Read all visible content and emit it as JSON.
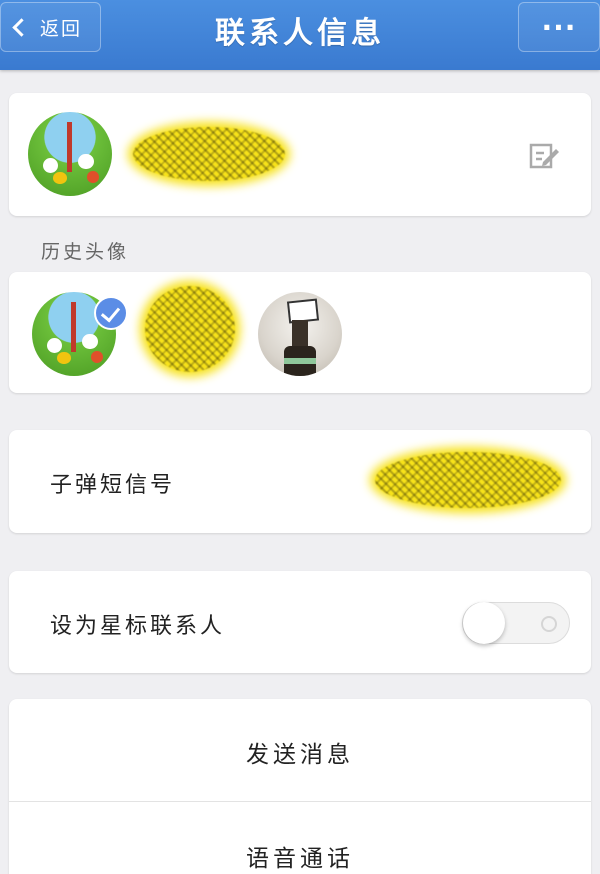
{
  "header": {
    "back_label": "返回",
    "title": "联系人信息",
    "more_label": "···"
  },
  "profile": {
    "edit_icon": "edit-icon"
  },
  "history": {
    "section_label": "历史头像"
  },
  "bullet_id": {
    "label": "子弹短信号"
  },
  "star_contact": {
    "label": "设为星标联系人",
    "enabled": false
  },
  "actions": {
    "send_message": "发送消息",
    "voice_call": "语音通话"
  },
  "colors": {
    "header": "#3a7ad0",
    "accent": "#5b8de6",
    "background": "#efeff2"
  }
}
